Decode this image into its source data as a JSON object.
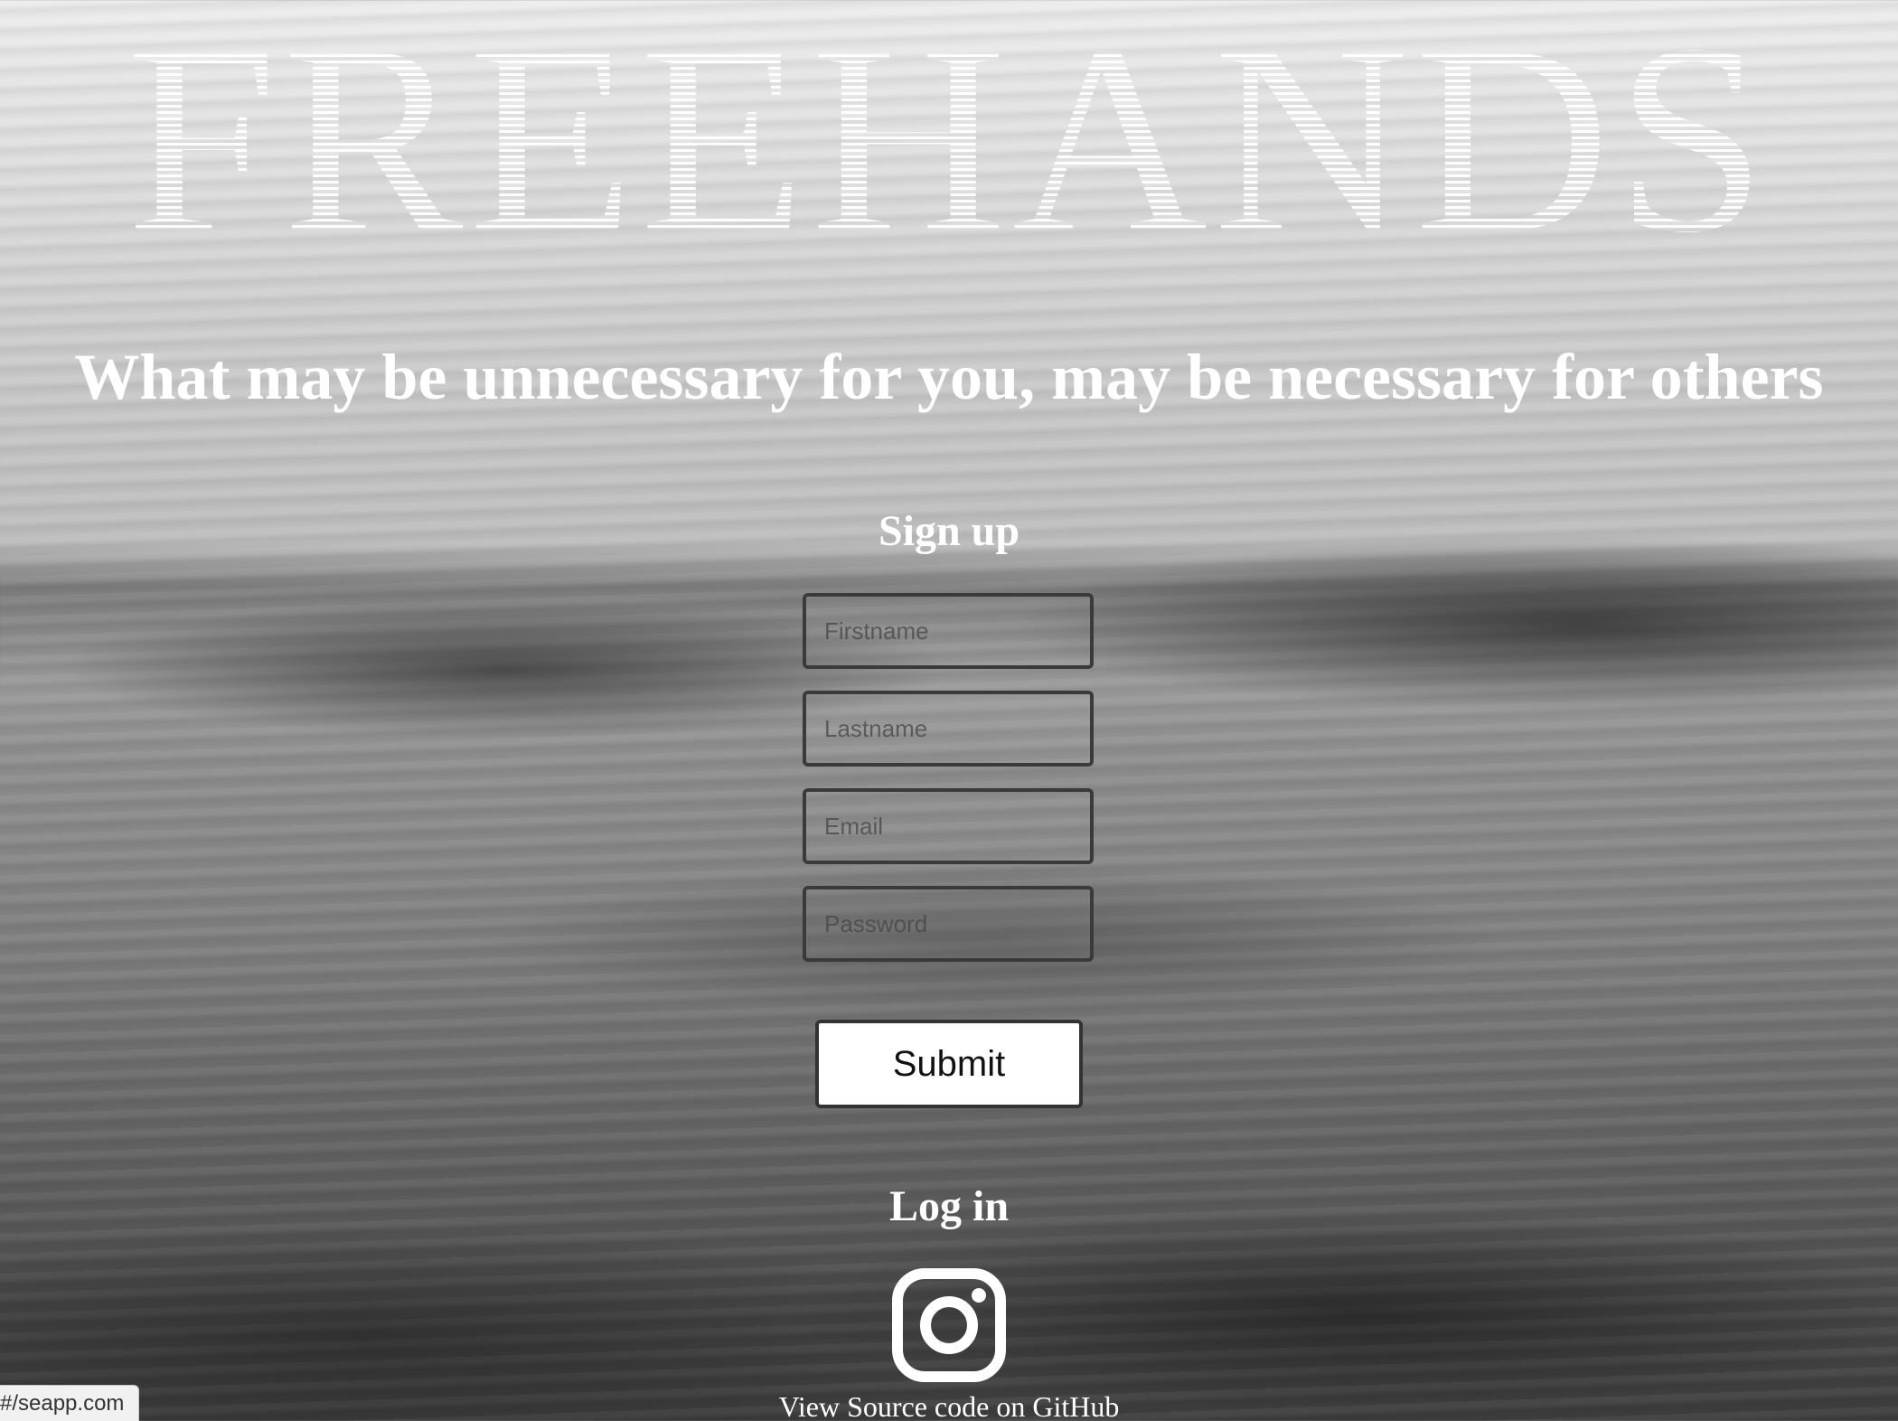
{
  "header": {
    "brand": "FREEHANDS",
    "tagline": "What may be unnecessary for you, may be necessary for others"
  },
  "signup": {
    "heading": "Sign up",
    "firstname_placeholder": "Firstname",
    "lastname_placeholder": "Lastname",
    "email_placeholder": "Email",
    "password_placeholder": "Password",
    "submit_label": "Submit"
  },
  "login": {
    "heading": "Log in",
    "icon": "instagram-icon"
  },
  "footer": {
    "github_link": "View Source code on GitHub"
  },
  "status_bar": {
    "url": "seapp.com/#"
  },
  "colors": {
    "text": "#ffffff",
    "button_background": "#ffffff",
    "field_border": "#3a3a3a"
  }
}
